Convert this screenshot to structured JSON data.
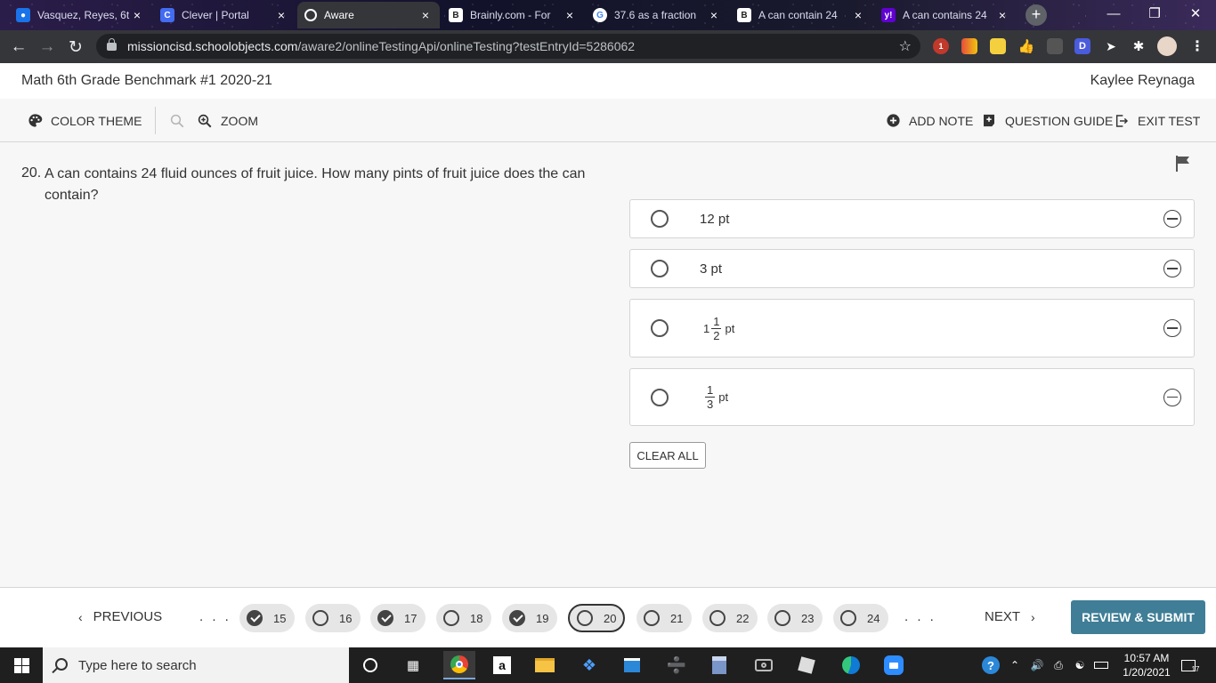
{
  "browser": {
    "tabs": [
      {
        "title": "Vasquez, Reyes, 6t",
        "favicon_color": "#1a73e8",
        "favicon_char": "",
        "active": false
      },
      {
        "title": "Clever | Portal",
        "favicon_color": "#436cf2",
        "favicon_char": "C",
        "active": false
      },
      {
        "title": "Aware",
        "favicon_color": "#ffffff",
        "favicon_char": "",
        "active": true
      },
      {
        "title": "Brainly.com - For",
        "favicon_color": "#222222",
        "favicon_char": "B",
        "active": false
      },
      {
        "title": "37.6 as a fraction",
        "favicon_color": "#ffffff",
        "favicon_char": "G",
        "active": false
      },
      {
        "title": "A can contain 24",
        "favicon_color": "#222222",
        "favicon_char": "B",
        "active": false
      },
      {
        "title": "A can contains 24",
        "favicon_color": "#6001d2",
        "favicon_char": "y!",
        "active": false
      }
    ],
    "url_host": "missioncisd.schoolobjects.com",
    "url_path": "/aware2/onlineTestingApi/onlineTesting?testEntryId=5286062",
    "extension_badge": "1"
  },
  "header": {
    "test_title": "Math 6th Grade Benchmark #1 2020-21",
    "student_name": "Kaylee Reynaga"
  },
  "tools": {
    "color_theme": "COLOR THEME",
    "zoom": "ZOOM",
    "add_note": "ADD NOTE",
    "question_guide": "QUESTION GUIDE",
    "exit_test": "EXIT TEST"
  },
  "question": {
    "number": "20.",
    "text": "A can contains 24 fluid ounces of fruit juice. How many pints of fruit juice does the can contain?",
    "options": [
      {
        "whole": "12",
        "unit": "pt"
      },
      {
        "whole": "3",
        "unit": "pt"
      },
      {
        "whole": "1",
        "num": "1",
        "den": "2",
        "unit": "pt"
      },
      {
        "num": "1",
        "den": "3",
        "unit": "pt"
      }
    ],
    "clear_all": "CLEAR ALL"
  },
  "navigation": {
    "previous": "PREVIOUS",
    "next": "NEXT",
    "ellipsis": ". . .",
    "questions": [
      {
        "n": "15",
        "answered": true
      },
      {
        "n": "16",
        "answered": false
      },
      {
        "n": "17",
        "answered": true
      },
      {
        "n": "18",
        "answered": false
      },
      {
        "n": "19",
        "answered": true
      },
      {
        "n": "20",
        "answered": false,
        "current": true
      },
      {
        "n": "21",
        "answered": false
      },
      {
        "n": "22",
        "answered": false
      },
      {
        "n": "23",
        "answered": false
      },
      {
        "n": "24",
        "answered": false
      }
    ],
    "review_submit": "REVIEW & SUBMIT"
  },
  "taskbar": {
    "search_placeholder": "Type here to search",
    "time": "10:57 AM",
    "date": "1/20/2021",
    "notification_count": "17"
  },
  "colors": {
    "accent": "#3f7e96",
    "chrome_toolbar": "#35363a"
  }
}
